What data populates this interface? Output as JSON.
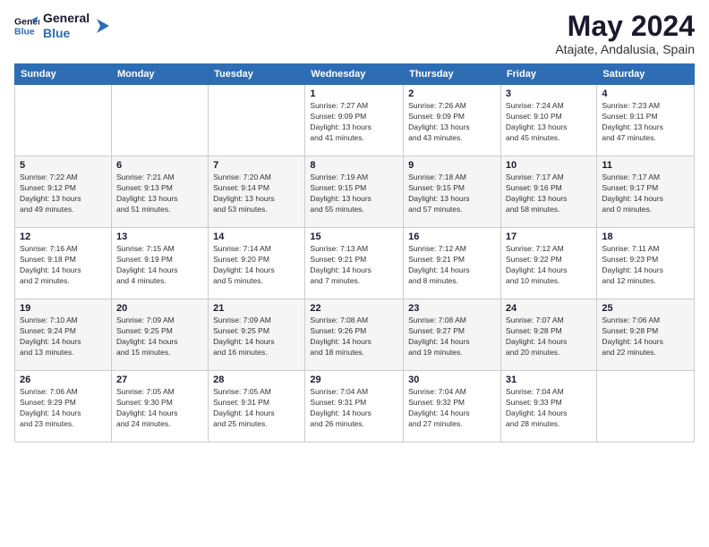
{
  "logo": {
    "line1": "General",
    "line2": "Blue"
  },
  "title": "May 2024",
  "subtitle": "Atajate, Andalusia, Spain",
  "days_of_week": [
    "Sunday",
    "Monday",
    "Tuesday",
    "Wednesday",
    "Thursday",
    "Friday",
    "Saturday"
  ],
  "weeks": [
    [
      {
        "num": "",
        "info": ""
      },
      {
        "num": "",
        "info": ""
      },
      {
        "num": "",
        "info": ""
      },
      {
        "num": "1",
        "info": "Sunrise: 7:27 AM\nSunset: 9:09 PM\nDaylight: 13 hours\nand 41 minutes."
      },
      {
        "num": "2",
        "info": "Sunrise: 7:26 AM\nSunset: 9:09 PM\nDaylight: 13 hours\nand 43 minutes."
      },
      {
        "num": "3",
        "info": "Sunrise: 7:24 AM\nSunset: 9:10 PM\nDaylight: 13 hours\nand 45 minutes."
      },
      {
        "num": "4",
        "info": "Sunrise: 7:23 AM\nSunset: 9:11 PM\nDaylight: 13 hours\nand 47 minutes."
      }
    ],
    [
      {
        "num": "5",
        "info": "Sunrise: 7:22 AM\nSunset: 9:12 PM\nDaylight: 13 hours\nand 49 minutes."
      },
      {
        "num": "6",
        "info": "Sunrise: 7:21 AM\nSunset: 9:13 PM\nDaylight: 13 hours\nand 51 minutes."
      },
      {
        "num": "7",
        "info": "Sunrise: 7:20 AM\nSunset: 9:14 PM\nDaylight: 13 hours\nand 53 minutes."
      },
      {
        "num": "8",
        "info": "Sunrise: 7:19 AM\nSunset: 9:15 PM\nDaylight: 13 hours\nand 55 minutes."
      },
      {
        "num": "9",
        "info": "Sunrise: 7:18 AM\nSunset: 9:15 PM\nDaylight: 13 hours\nand 57 minutes."
      },
      {
        "num": "10",
        "info": "Sunrise: 7:17 AM\nSunset: 9:16 PM\nDaylight: 13 hours\nand 58 minutes."
      },
      {
        "num": "11",
        "info": "Sunrise: 7:17 AM\nSunset: 9:17 PM\nDaylight: 14 hours\nand 0 minutes."
      }
    ],
    [
      {
        "num": "12",
        "info": "Sunrise: 7:16 AM\nSunset: 9:18 PM\nDaylight: 14 hours\nand 2 minutes."
      },
      {
        "num": "13",
        "info": "Sunrise: 7:15 AM\nSunset: 9:19 PM\nDaylight: 14 hours\nand 4 minutes."
      },
      {
        "num": "14",
        "info": "Sunrise: 7:14 AM\nSunset: 9:20 PM\nDaylight: 14 hours\nand 5 minutes."
      },
      {
        "num": "15",
        "info": "Sunrise: 7:13 AM\nSunset: 9:21 PM\nDaylight: 14 hours\nand 7 minutes."
      },
      {
        "num": "16",
        "info": "Sunrise: 7:12 AM\nSunset: 9:21 PM\nDaylight: 14 hours\nand 8 minutes."
      },
      {
        "num": "17",
        "info": "Sunrise: 7:12 AM\nSunset: 9:22 PM\nDaylight: 14 hours\nand 10 minutes."
      },
      {
        "num": "18",
        "info": "Sunrise: 7:11 AM\nSunset: 9:23 PM\nDaylight: 14 hours\nand 12 minutes."
      }
    ],
    [
      {
        "num": "19",
        "info": "Sunrise: 7:10 AM\nSunset: 9:24 PM\nDaylight: 14 hours\nand 13 minutes."
      },
      {
        "num": "20",
        "info": "Sunrise: 7:09 AM\nSunset: 9:25 PM\nDaylight: 14 hours\nand 15 minutes."
      },
      {
        "num": "21",
        "info": "Sunrise: 7:09 AM\nSunset: 9:25 PM\nDaylight: 14 hours\nand 16 minutes."
      },
      {
        "num": "22",
        "info": "Sunrise: 7:08 AM\nSunset: 9:26 PM\nDaylight: 14 hours\nand 18 minutes."
      },
      {
        "num": "23",
        "info": "Sunrise: 7:08 AM\nSunset: 9:27 PM\nDaylight: 14 hours\nand 19 minutes."
      },
      {
        "num": "24",
        "info": "Sunrise: 7:07 AM\nSunset: 9:28 PM\nDaylight: 14 hours\nand 20 minutes."
      },
      {
        "num": "25",
        "info": "Sunrise: 7:06 AM\nSunset: 9:28 PM\nDaylight: 14 hours\nand 22 minutes."
      }
    ],
    [
      {
        "num": "26",
        "info": "Sunrise: 7:06 AM\nSunset: 9:29 PM\nDaylight: 14 hours\nand 23 minutes."
      },
      {
        "num": "27",
        "info": "Sunrise: 7:05 AM\nSunset: 9:30 PM\nDaylight: 14 hours\nand 24 minutes."
      },
      {
        "num": "28",
        "info": "Sunrise: 7:05 AM\nSunset: 9:31 PM\nDaylight: 14 hours\nand 25 minutes."
      },
      {
        "num": "29",
        "info": "Sunrise: 7:04 AM\nSunset: 9:31 PM\nDaylight: 14 hours\nand 26 minutes."
      },
      {
        "num": "30",
        "info": "Sunrise: 7:04 AM\nSunset: 9:32 PM\nDaylight: 14 hours\nand 27 minutes."
      },
      {
        "num": "31",
        "info": "Sunrise: 7:04 AM\nSunset: 9:33 PM\nDaylight: 14 hours\nand 28 minutes."
      },
      {
        "num": "",
        "info": ""
      }
    ]
  ]
}
